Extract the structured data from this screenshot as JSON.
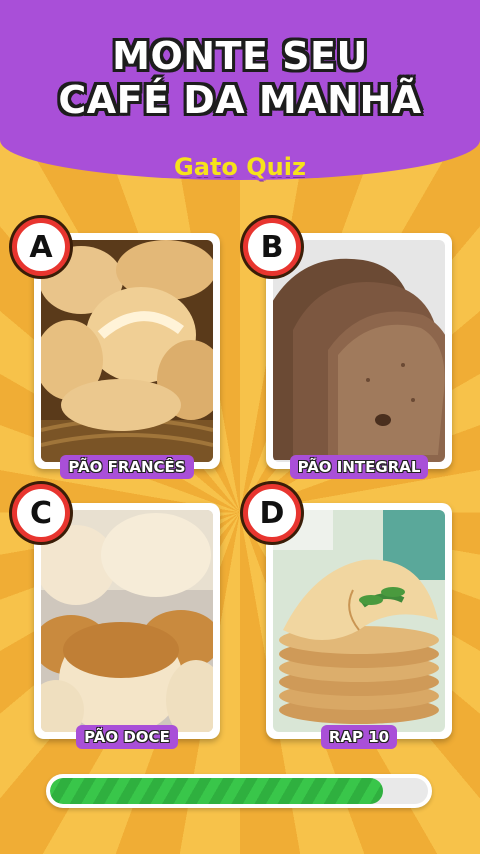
{
  "header": {
    "title_line1": "MONTE SEU",
    "title_line2": "CAFÉ DA MANHÃ",
    "brand": "Gato Quiz"
  },
  "options": [
    {
      "letter": "A",
      "label": "PÃO FRANCÊS",
      "image": "french-rolls-in-basket"
    },
    {
      "letter": "B",
      "label": "PÃO INTEGRAL",
      "image": "sliced-whole-wheat-bread"
    },
    {
      "letter": "C",
      "label": "PÃO DOCE",
      "image": "sweet-bread-rolls"
    },
    {
      "letter": "D",
      "label": "RAP 10",
      "image": "stack-of-crepes"
    }
  ],
  "progress": {
    "fraction": 0.88
  },
  "colors": {
    "header_purple": "#a94fd8",
    "background_orange": "#f3b53a",
    "badge_red": "#e8352f",
    "brand_yellow": "#f6e21b",
    "progress_green": "#39c64a"
  }
}
